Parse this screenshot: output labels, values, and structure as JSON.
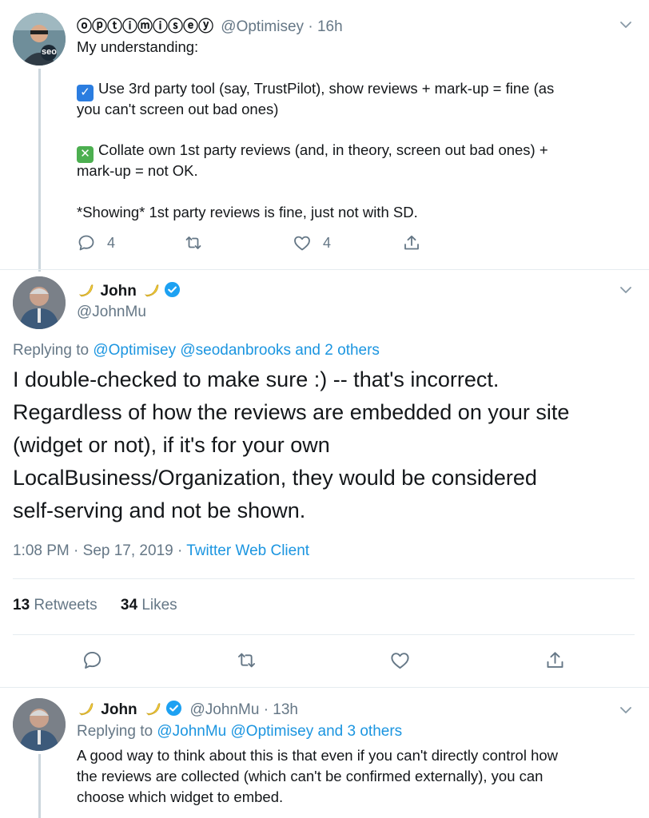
{
  "tweet1": {
    "display_name": "ⓞⓟⓣⓘⓜⓘⓢⓔⓨ",
    "handle": "@Optimisey",
    "separator": "·",
    "time": "16h",
    "avatar_text": "seo",
    "text_intro": "My understanding:",
    "check_line_1": "Use 3rd party tool (say, TrustPilot), show reviews + mark-up = fine (as",
    "check_line_2": "you can't screen out bad ones)",
    "cross_line_1": "Collate own 1st party reviews (and, in theory, screen out bad ones) +",
    "cross_line_2": "mark-up = not OK.",
    "note": "*Showing* 1st party reviews is fine, just not with SD.",
    "reply_count": "4",
    "like_count": "4"
  },
  "tweet2": {
    "display_name": "John",
    "handle": "@JohnMu",
    "replying_prefix": "Replying to",
    "replying_to": "@Optimisey @seodanbrooks and 2 others",
    "text_lines": [
      "I double-checked to make sure :) -- that's incorrect.",
      "Regardless of how the reviews are embedded on your site",
      "(widget or not), if it's for your own",
      "LocalBusiness/Organization, they would be considered",
      "self-serving and not be shown."
    ],
    "time": "1:08 PM",
    "date": "Sep 17, 2019",
    "client": "Twitter Web Client",
    "retweets_count": "13",
    "retweets_label": "Retweets",
    "likes_count": "34",
    "likes_label": "Likes"
  },
  "tweet3": {
    "display_name": "John",
    "handle": "@JohnMu",
    "separator": "·",
    "time": "13h",
    "replying_prefix": "Replying to",
    "replying_to": "@JohnMu @Optimisey and 3 others",
    "text_lines": [
      "A good way to think about this is that even if you can't directly control how",
      "the reviews are collected (which can't be confirmed externally), you can",
      "choose which widget to embed."
    ]
  },
  "colors": {
    "accent": "#1b95e0",
    "muted": "#657786",
    "check_badge": "#2b7de0",
    "cross_badge": "#4caf50"
  }
}
